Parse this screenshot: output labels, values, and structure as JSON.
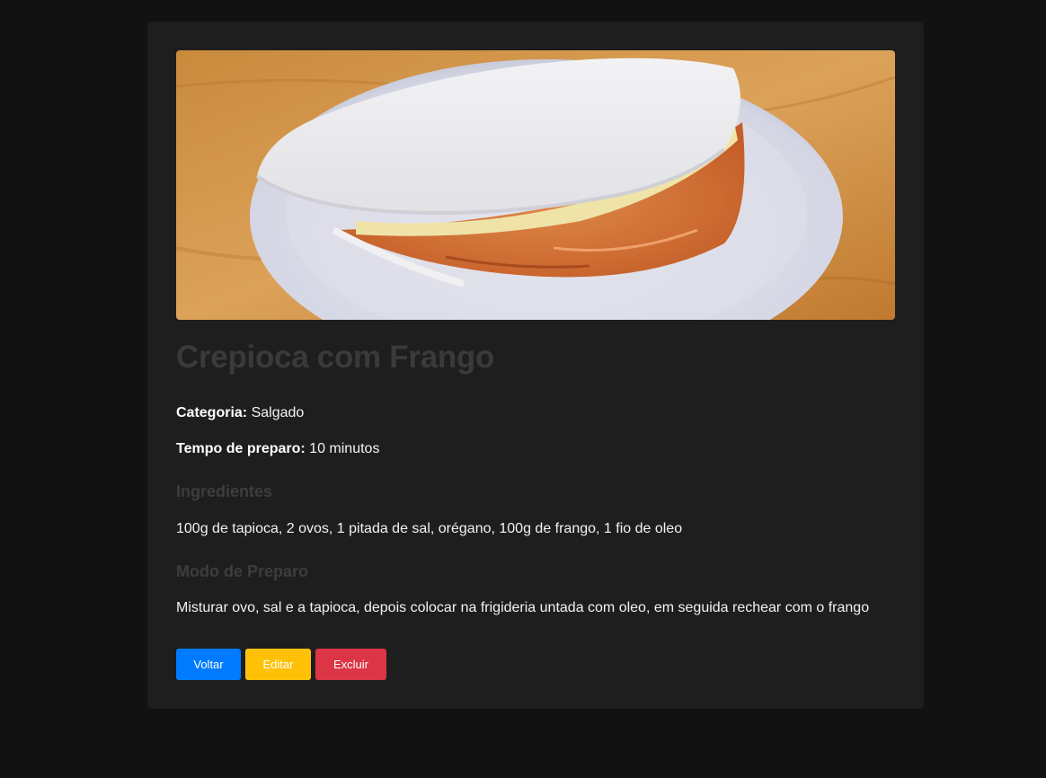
{
  "recipe": {
    "image_alt": "Crepioca com frango no prato",
    "title": "Crepioca com Frango",
    "category_label": "Categoria:",
    "category_value": "Salgado",
    "time_label": "Tempo de preparo:",
    "time_value": "10 minutos",
    "ingredients_title": "Ingredientes",
    "ingredients_text": "100g de tapioca, 2 ovos, 1 pitada de sal, orégano, 100g de frango, 1 fio de oleo",
    "method_title": "Modo de Preparo",
    "method_text": "Misturar ovo, sal e a tapioca, depois colocar na frigideria untada com oleo, em seguida rechear com o frango"
  },
  "actions": {
    "back_label": "Voltar",
    "edit_label": "Editar",
    "delete_label": "Excluir"
  },
  "colors": {
    "page_bg": "#121212",
    "card_bg": "#1e1e1e",
    "back_button": "#007bff",
    "edit_button": "#ffc107",
    "delete_button": "#dc3545"
  }
}
